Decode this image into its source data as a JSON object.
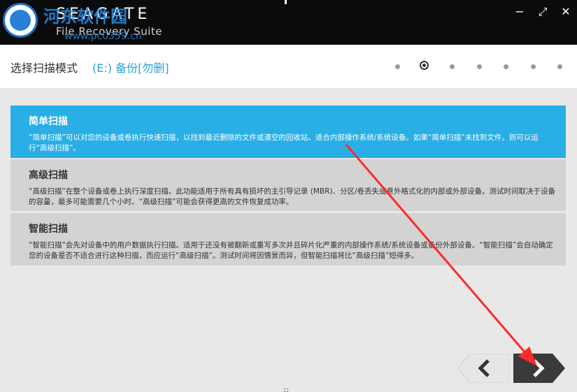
{
  "titlebar": {
    "brand": "SEAGATE",
    "product": "File Recovery Suite",
    "watermark": "河东软件园",
    "watermark_url": "www.pc0359.cn",
    "minimize": "−",
    "maximize": "⤢",
    "close": "✕"
  },
  "header": {
    "title": "选择扫描模式",
    "drive": "(E:) 备份[勿删]",
    "steps_total": 7,
    "active_step": 2
  },
  "options": [
    {
      "title": "简单扫描",
      "desc": "“简单扫描”可以对您的设备或卷执行快速扫描，以找到最近删除的文件或清空的回收站。适合内部操作系统/系统设备。如果“简单扫描”未找到文件，则可以运行“高级扫描”。",
      "selected": true
    },
    {
      "title": "高级扫描",
      "desc": "“高级扫描”在整个设备或卷上执行深度扫描。此功能适用于所有具有损坏的主引导记录 (MBR)、分区/卷丢失或意外格式化的内部或外部设备。测试时间取决于设备的容量，最多可能需要几个小时。“高级扫描”可能会获得更高的文件恢复成功率。",
      "selected": false
    },
    {
      "title": "智能扫描",
      "desc": "“智能扫描”会先对设备中的用户数据执行扫描。适用于还没有被翻新或重写多次并且碎片化严重的内部操作系统/系统设备或备份外部设备。“智能扫描”会自动确定您的设备是否不适合进行这种扫描，而应运行“高级扫描”。测试时间将因情景而异，但智能扫描将比“高级扫描”短得多。",
      "selected": false
    }
  ],
  "nav": {
    "back_icon": "chevron-left",
    "next_icon": "chevron-right"
  },
  "colors": {
    "accent": "#29aee5",
    "annotation_arrow": "#ff2a2a",
    "nav_back": "#e8e8e8",
    "nav_next": "#3a3a3a"
  }
}
